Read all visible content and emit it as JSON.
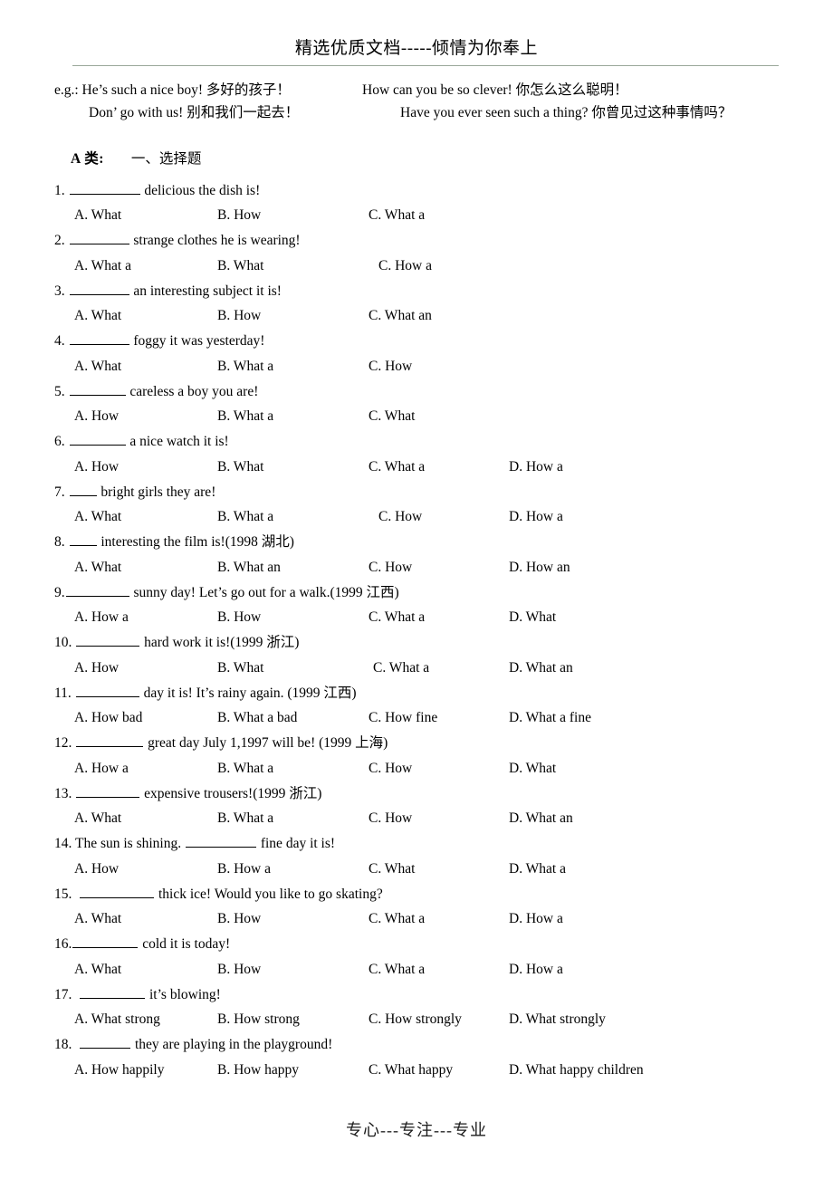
{
  "header": {
    "watermark": "精选优质文档-----倾情为你奉上"
  },
  "footer": {
    "watermark": "专心---专注---专业"
  },
  "examples": [
    {
      "left": "e.g.: He’s such a nice boy!  多好的孩子！",
      "right": "How can you be so clever!  你怎么这么聪明！",
      "indent": false
    },
    {
      "left": "Don’ go with us!  别和我们一起去！",
      "right": "Have you ever seen such a thing?   你曾见过这种事情吗？",
      "indent": true
    }
  ],
  "section": {
    "class_label": "A 类:",
    "subtitle": "一、选择题"
  },
  "questions": [
    {
      "num": "1.",
      "gap_before": " ",
      "blank_width": 78,
      "text_after": " delicious the dish is!",
      "options": [
        "A. What",
        "B. How",
        "C. What a"
      ]
    },
    {
      "num": "2.",
      "gap_before": " ",
      "blank_width": 66,
      "text_after": " strange clothes he is wearing!",
      "options": [
        "A. What a",
        "B. What",
        "C. How a"
      ]
    },
    {
      "num": "3.",
      "gap_before": " ",
      "blank_width": 66,
      "text_after": " an interesting subject it is!",
      "options": [
        "A. What",
        "B. How",
        "C. What an"
      ]
    },
    {
      "num": "4.",
      "gap_before": " ",
      "blank_width": 66,
      "text_after": " foggy it was yesterday!",
      "options": [
        "A. What",
        "B. What a",
        "C. How"
      ]
    },
    {
      "num": "5.",
      "gap_before": " ",
      "blank_width": 62,
      "text_after": " careless a boy you are!",
      "options": [
        "A. How",
        "B. What a",
        "C. What"
      ]
    },
    {
      "num": "6.",
      "gap_before": " ",
      "blank_width": 62,
      "text_after": " a nice watch it is!",
      "options": [
        "A. How",
        "B. What",
        "C. What a",
        "D. How a"
      ]
    },
    {
      "num": "7.",
      "gap_before": " ",
      "blank_width": 30,
      "text_after": " bright girls they are!",
      "options": [
        "A. What",
        "B. What a",
        "C. How",
        "D. How a"
      ]
    },
    {
      "num": "8.",
      "gap_before": " ",
      "blank_width": 30,
      "text_after": " interesting the film is!(1998 湖北)",
      "options": [
        "A. What",
        "B. What an",
        "C. How",
        "D. How an"
      ]
    },
    {
      "num": "9.",
      "gap_before": "",
      "blank_width": 70,
      "text_after": " sunny day! Let’s go out for a walk.(1999 江西)",
      "options": [
        "A. How a",
        "B. How",
        "C. What a",
        "D. What"
      ]
    },
    {
      "num": "10.",
      "gap_before": " ",
      "blank_width": 70,
      "text_after": " hard work it is!(1999 浙江)",
      "options": [
        "A. How",
        "B. What",
        "C. What a",
        "D. What an"
      ]
    },
    {
      "num": "11.",
      "gap_before": " ",
      "blank_width": 70,
      "text_after": " day it is! It’s rainy again. (1999 江西)",
      "options": [
        "A. How bad",
        "B. What a bad",
        "C. How fine",
        "D. What a fine"
      ]
    },
    {
      "num": "12.",
      "gap_before": " ",
      "blank_width": 74,
      "text_after": " great day July 1,1997 will be! (1999 上海)",
      "options": [
        "A. How a",
        "B. What a",
        "C. How",
        "D. What"
      ]
    },
    {
      "num": "13.",
      "gap_before": " ",
      "blank_width": 70,
      "text_after": " expensive trousers!(1999 浙江)",
      "options": [
        "A. What",
        "B. What a",
        "C. How",
        "D. What an"
      ]
    },
    {
      "num": "14.",
      "gap_before": " The sun is shining. ",
      "blank_width": 78,
      "text_after": " fine day it is!",
      "options": [
        "A. How",
        "B. How a",
        "C. What",
        "D. What a"
      ]
    },
    {
      "num": "15.",
      "gap_before": "  ",
      "blank_width": 82,
      "text_after": " thick ice! Would you like to go skating?",
      "options": [
        "A. What",
        "B. How",
        "C. What a",
        "D. How a"
      ]
    },
    {
      "num": "16.",
      "gap_before": "",
      "blank_width": 72,
      "text_after": " cold it is today!",
      "options": [
        "A. What",
        "B. How",
        "C. What a",
        "D. How a"
      ]
    },
    {
      "num": "17.",
      "gap_before": "  ",
      "blank_width": 72,
      "text_after": " it’s blowing!",
      "options": [
        "A. What strong",
        "B. How strong",
        "C. How strongly",
        "D. What strongly"
      ]
    },
    {
      "num": "18.",
      "gap_before": "  ",
      "blank_width": 56,
      "text_after": " they are playing in the playground!",
      "options": [
        "A. How happily",
        "B. How happy",
        "C. What happy",
        "D. What happy children"
      ]
    }
  ]
}
